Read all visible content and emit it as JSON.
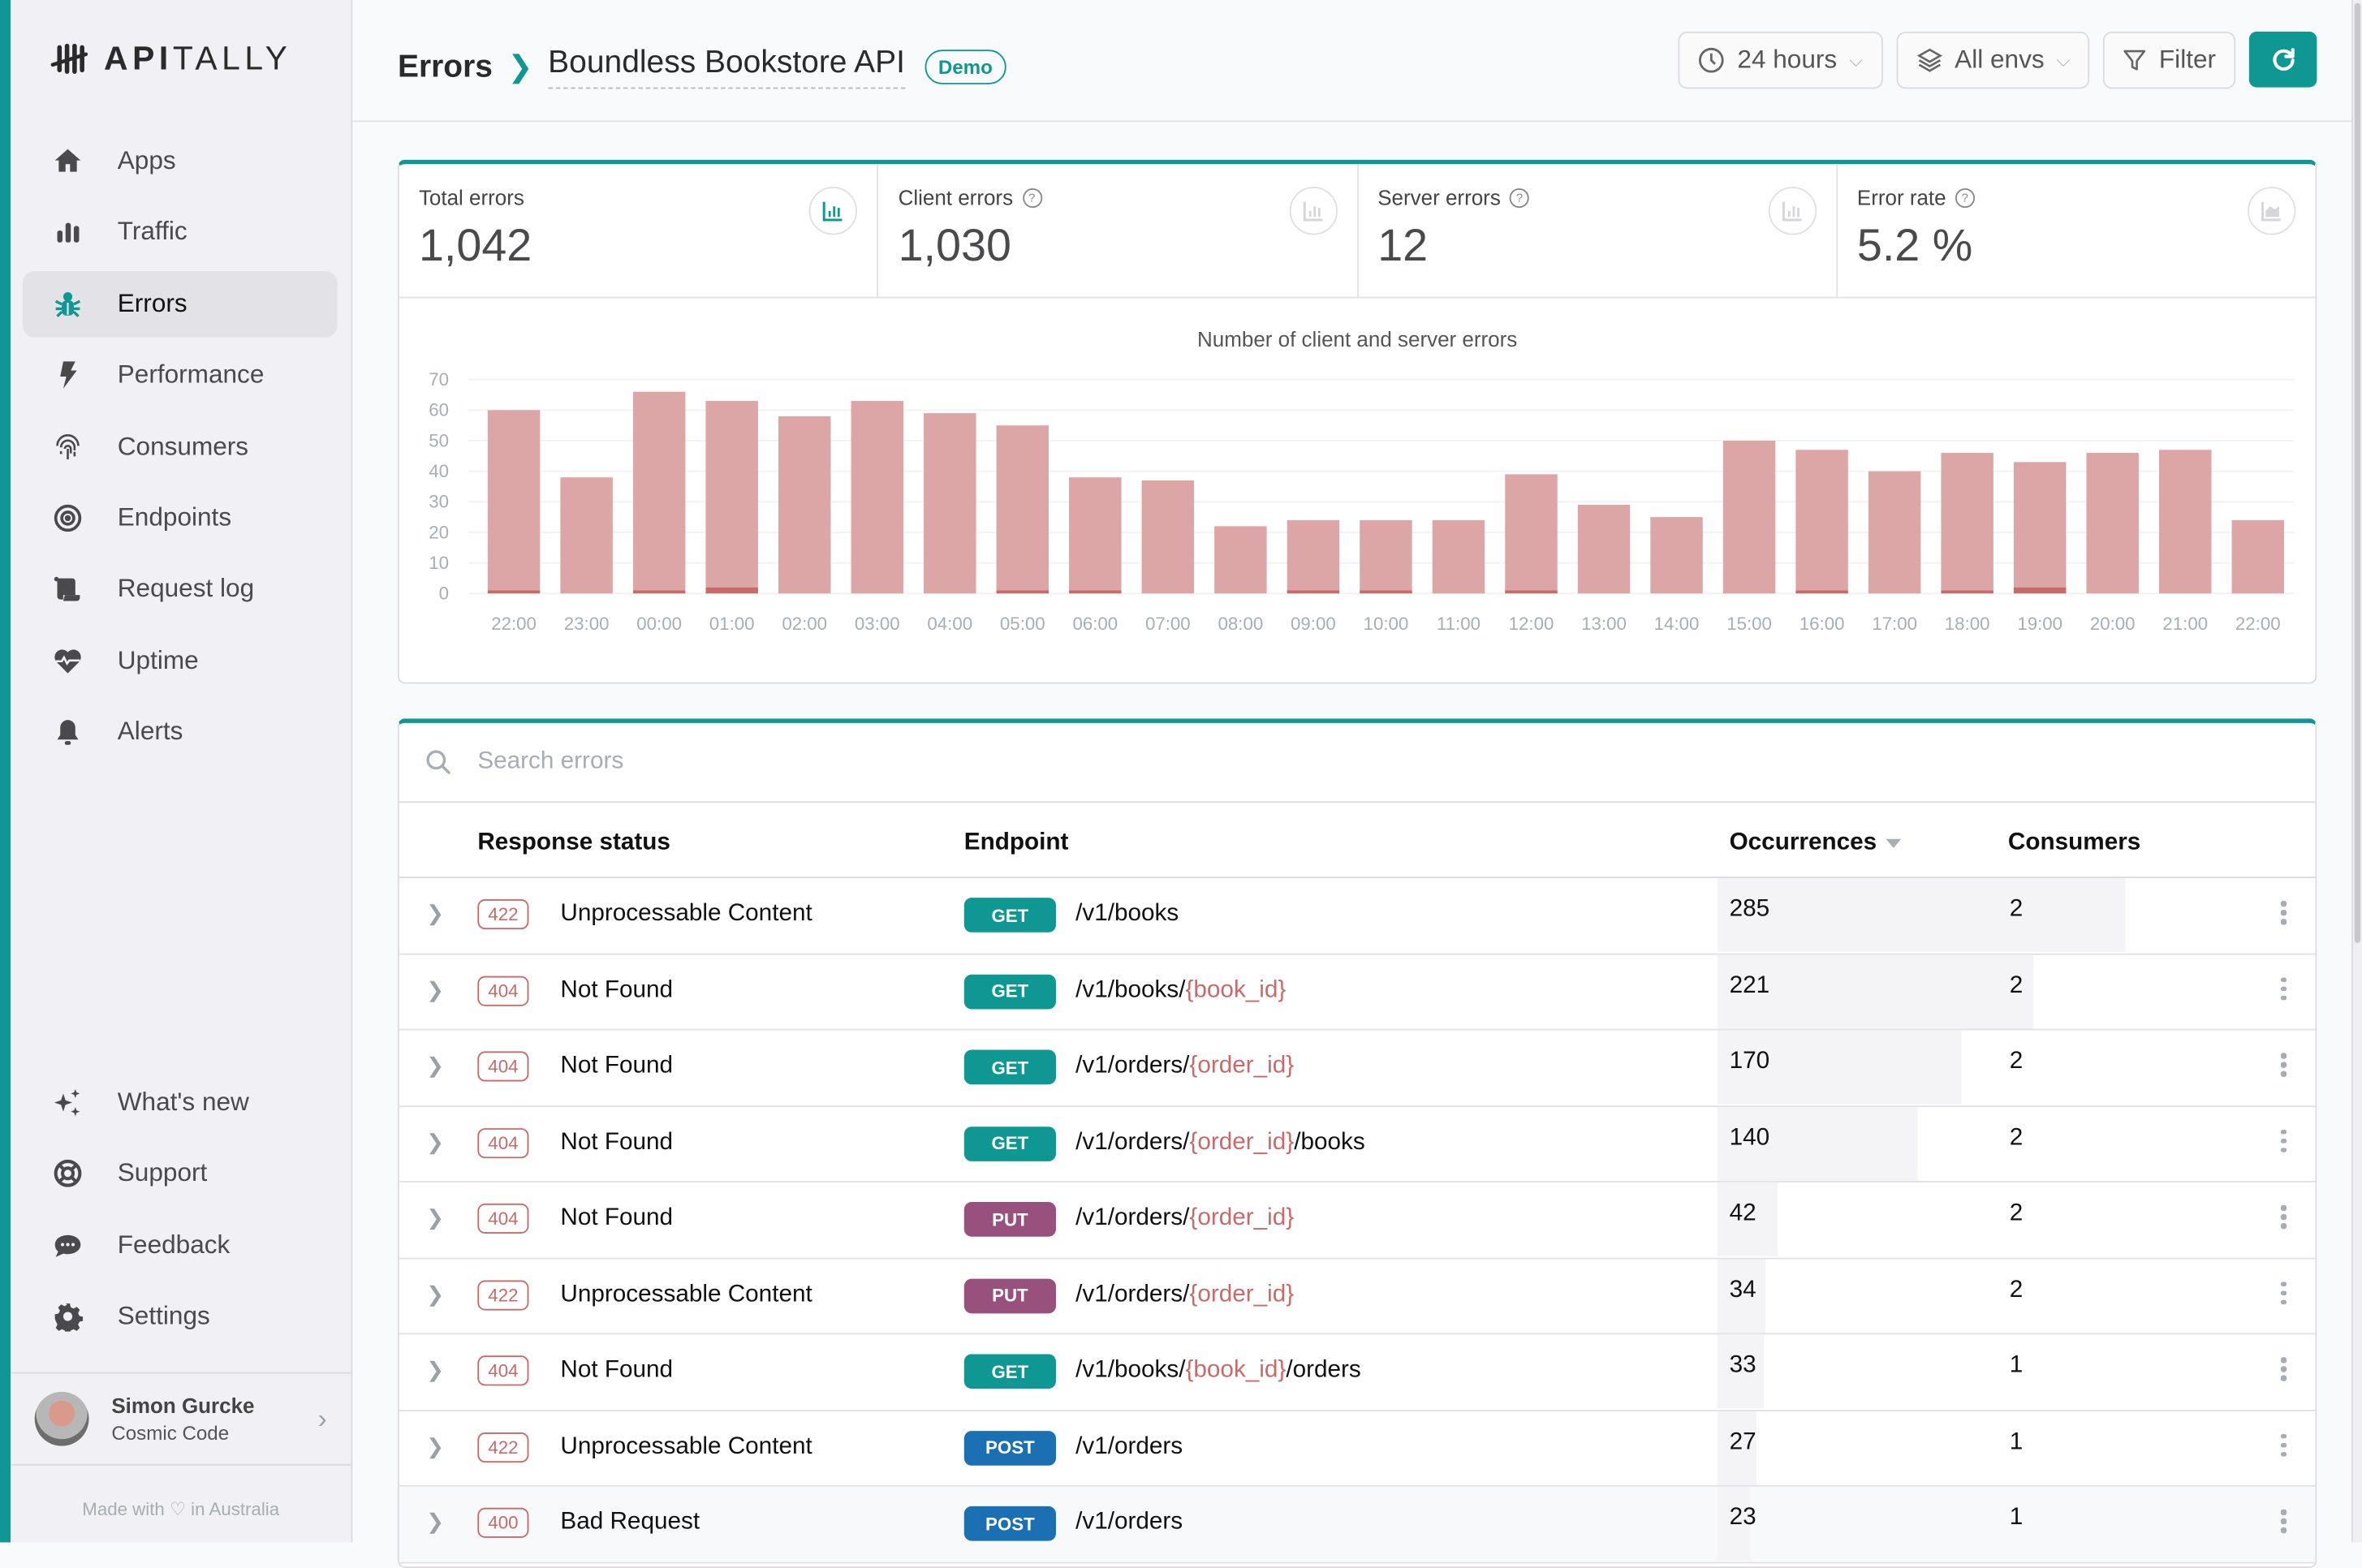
{
  "app": {
    "logo_bold": "API",
    "logo_light": "TALLY"
  },
  "sidebar": {
    "items": [
      {
        "label": "Apps",
        "icon": "home-icon"
      },
      {
        "label": "Traffic",
        "icon": "bar-chart-icon"
      },
      {
        "label": "Errors",
        "icon": "bug-icon",
        "active": true
      },
      {
        "label": "Performance",
        "icon": "bolt-icon"
      },
      {
        "label": "Consumers",
        "icon": "fingerprint-icon"
      },
      {
        "label": "Endpoints",
        "icon": "target-icon"
      },
      {
        "label": "Request log",
        "icon": "scroll-icon"
      },
      {
        "label": "Uptime",
        "icon": "heart-pulse-icon"
      },
      {
        "label": "Alerts",
        "icon": "bell-icon"
      }
    ],
    "bottom_items": [
      {
        "label": "What's new",
        "icon": "sparkles-icon"
      },
      {
        "label": "Support",
        "icon": "lifebuoy-icon"
      },
      {
        "label": "Feedback",
        "icon": "chat-bubble-icon"
      },
      {
        "label": "Settings",
        "icon": "gear-icon"
      }
    ],
    "user": {
      "name": "Simon Gurcke",
      "org": "Cosmic Code"
    },
    "footer": {
      "before": "Made with",
      "after": "in Australia"
    }
  },
  "header": {
    "breadcrumb_root": "Errors",
    "app_name": "Boundless Bookstore API",
    "badge": "Demo",
    "period": "24 hours",
    "env": "All envs",
    "filter": "Filter"
  },
  "stats": [
    {
      "label": "Total errors",
      "value": "1,042",
      "help": false,
      "active": true
    },
    {
      "label": "Client errors",
      "value": "1,030",
      "help": true,
      "active": false
    },
    {
      "label": "Server errors",
      "value": "12",
      "help": true,
      "active": false
    },
    {
      "label": "Error rate",
      "value": "5.2 %",
      "help": true,
      "active": false
    }
  ],
  "chart_data": {
    "type": "bar",
    "stacked": true,
    "title": "Number of client and server errors",
    "xlabel": "",
    "ylabel": "",
    "ylim": [
      0,
      70
    ],
    "yticks": [
      0,
      10,
      20,
      30,
      40,
      50,
      60,
      70
    ],
    "grid": true,
    "categories": [
      "22:00",
      "23:00",
      "00:00",
      "01:00",
      "02:00",
      "03:00",
      "04:00",
      "05:00",
      "06:00",
      "07:00",
      "08:00",
      "09:00",
      "10:00",
      "11:00",
      "12:00",
      "13:00",
      "14:00",
      "15:00",
      "16:00",
      "17:00",
      "18:00",
      "19:00",
      "20:00",
      "21:00",
      "22:00"
    ],
    "series": [
      {
        "name": "Server errors",
        "color": "#c96a6a",
        "values": [
          1,
          0,
          1,
          2,
          0,
          0,
          0,
          1,
          1,
          0,
          0,
          1,
          1,
          0,
          1,
          0,
          0,
          0,
          1,
          0,
          1,
          2,
          0,
          0,
          0
        ]
      },
      {
        "name": "Client errors",
        "color": "#dca5a6",
        "values": [
          59,
          38,
          65,
          61,
          58,
          63,
          59,
          54,
          37,
          37,
          22,
          23,
          23,
          24,
          38,
          29,
          25,
          50,
          46,
          40,
          45,
          41,
          46,
          47,
          24
        ]
      }
    ]
  },
  "errors_table": {
    "search_placeholder": "Search errors",
    "columns": [
      "Response status",
      "Endpoint",
      "Occurrences",
      "Consumers"
    ],
    "max_occurrences": 285,
    "rows": [
      {
        "code": "422",
        "status": "Unprocessable Content",
        "method": "GET",
        "path": [
          {
            "t": "/v1/books"
          }
        ],
        "occurrences": 285,
        "consumers": 2
      },
      {
        "code": "404",
        "status": "Not Found",
        "method": "GET",
        "path": [
          {
            "t": "/v1/books/"
          },
          {
            "t": "{book_id}",
            "p": true
          }
        ],
        "occurrences": 221,
        "consumers": 2
      },
      {
        "code": "404",
        "status": "Not Found",
        "method": "GET",
        "path": [
          {
            "t": "/v1/orders/"
          },
          {
            "t": "{order_id}",
            "p": true
          }
        ],
        "occurrences": 170,
        "consumers": 2
      },
      {
        "code": "404",
        "status": "Not Found",
        "method": "GET",
        "path": [
          {
            "t": "/v1/orders/"
          },
          {
            "t": "{order_id}",
            "p": true
          },
          {
            "t": "/books"
          }
        ],
        "occurrences": 140,
        "consumers": 2
      },
      {
        "code": "404",
        "status": "Not Found",
        "method": "PUT",
        "path": [
          {
            "t": "/v1/orders/"
          },
          {
            "t": "{order_id}",
            "p": true
          }
        ],
        "occurrences": 42,
        "consumers": 2
      },
      {
        "code": "422",
        "status": "Unprocessable Content",
        "method": "PUT",
        "path": [
          {
            "t": "/v1/orders/"
          },
          {
            "t": "{order_id}",
            "p": true
          }
        ],
        "occurrences": 34,
        "consumers": 2
      },
      {
        "code": "404",
        "status": "Not Found",
        "method": "GET",
        "path": [
          {
            "t": "/v1/books/"
          },
          {
            "t": "{book_id}",
            "p": true
          },
          {
            "t": "/orders"
          }
        ],
        "occurrences": 33,
        "consumers": 1
      },
      {
        "code": "422",
        "status": "Unprocessable Content",
        "method": "POST",
        "path": [
          {
            "t": "/v1/orders"
          }
        ],
        "occurrences": 27,
        "consumers": 1
      },
      {
        "code": "400",
        "status": "Bad Request",
        "method": "POST",
        "path": [
          {
            "t": "/v1/orders"
          }
        ],
        "occurrences": 23,
        "consumers": 1,
        "hover": true
      }
    ]
  },
  "colors": {
    "accent": "#0f9794",
    "get": "#0f9794",
    "put": "#98507c",
    "post": "#1b6fb3",
    "error": "#c96a6a"
  }
}
